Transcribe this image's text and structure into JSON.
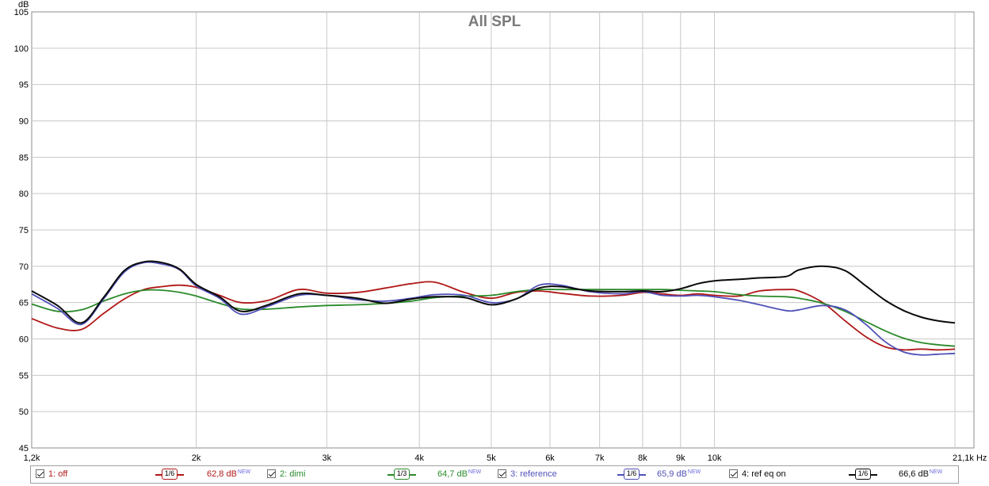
{
  "chart_data": {
    "type": "line",
    "title": "All SPL",
    "ylabel": "dB",
    "xlabel": "Hz",
    "x_scale": "log",
    "xlim": [
      1200,
      21100
    ],
    "ylim": [
      45,
      105
    ],
    "yticks": [
      45,
      50,
      55,
      60,
      65,
      70,
      75,
      80,
      85,
      90,
      95,
      100,
      105
    ],
    "xticks": [
      {
        "value": 1200,
        "label": "1,2k"
      },
      {
        "value": 2000,
        "label": "2k"
      },
      {
        "value": 3000,
        "label": "3k"
      },
      {
        "value": 4000,
        "label": "4k"
      },
      {
        "value": 5000,
        "label": "5k"
      },
      {
        "value": 6000,
        "label": "6k"
      },
      {
        "value": 7000,
        "label": "7k"
      },
      {
        "value": 8000,
        "label": "8k"
      },
      {
        "value": 9000,
        "label": "9k"
      },
      {
        "value": 10000,
        "label": "10k"
      },
      {
        "value": 21100,
        "label": "21,1k Hz"
      }
    ],
    "grid": true,
    "series": [
      {
        "name": "1: off",
        "color": "#b01818",
        "x": [
          1200,
          1300,
          1400,
          1500,
          1600,
          1700,
          1800,
          1900,
          2000,
          2150,
          2300,
          2500,
          2750,
          3000,
          3300,
          3600,
          3900,
          4200,
          4600,
          5000,
          5400,
          5800,
          6200,
          6800,
          7500,
          8000,
          8500,
          9000,
          9500,
          10000,
          10800,
          11500,
          12500,
          13000,
          14000,
          15000,
          16000,
          17000,
          18000,
          19000,
          20000,
          21100
        ],
        "y": [
          62.8,
          61.5,
          61.3,
          63.5,
          65.5,
          66.8,
          67.2,
          67.4,
          67.1,
          66.0,
          65.0,
          65.3,
          66.8,
          66.3,
          66.4,
          67.0,
          67.6,
          67.8,
          66.4,
          65.6,
          66.4,
          66.6,
          66.3,
          65.9,
          66.0,
          66.4,
          66.2,
          66.0,
          66.2,
          66.0,
          65.9,
          66.6,
          66.8,
          66.6,
          65.0,
          62.5,
          60.3,
          58.9,
          58.5,
          58.6,
          58.5,
          58.6
        ]
      },
      {
        "name": "2: dimi",
        "color": "#2a8a2a",
        "x": [
          1200,
          1300,
          1400,
          1500,
          1600,
          1700,
          1800,
          1900,
          2000,
          2150,
          2300,
          2500,
          2750,
          3000,
          3300,
          3600,
          3900,
          4200,
          4600,
          5000,
          5400,
          5800,
          6200,
          6800,
          7500,
          8000,
          8500,
          9000,
          9500,
          10000,
          10800,
          11500,
          12500,
          13000,
          14000,
          15000,
          16000,
          17000,
          18000,
          19000,
          20000,
          21100
        ],
        "y": [
          64.8,
          63.8,
          64.0,
          65.2,
          66.2,
          66.7,
          66.7,
          66.4,
          65.9,
          64.9,
          64.1,
          64.1,
          64.4,
          64.6,
          64.7,
          64.9,
          65.2,
          65.7,
          65.9,
          66.0,
          66.5,
          66.8,
          66.8,
          66.8,
          66.8,
          66.8,
          66.8,
          66.7,
          66.6,
          66.5,
          66.1,
          65.9,
          65.8,
          65.6,
          64.9,
          63.8,
          62.4,
          61.1,
          60.1,
          59.5,
          59.2,
          59.0
        ]
      },
      {
        "name": "3: reference",
        "color": "#5050b8",
        "x": [
          1200,
          1300,
          1400,
          1500,
          1600,
          1700,
          1800,
          1900,
          2000,
          2150,
          2300,
          2500,
          2750,
          3000,
          3300,
          3600,
          3900,
          4200,
          4600,
          5000,
          5400,
          5800,
          6200,
          6800,
          7500,
          8000,
          8500,
          9000,
          9500,
          10000,
          10800,
          11500,
          12500,
          13000,
          14000,
          15000,
          16000,
          17000,
          18000,
          19000,
          20000,
          21100
        ],
        "y": [
          66.2,
          64.2,
          62.0,
          65.5,
          69.2,
          70.5,
          70.3,
          69.5,
          67.3,
          65.6,
          63.4,
          64.5,
          66.0,
          66.0,
          65.4,
          65.2,
          65.6,
          66.1,
          66.0,
          65.0,
          65.5,
          67.4,
          67.4,
          66.5,
          66.2,
          66.5,
          66.0,
          65.9,
          66.0,
          65.8,
          65.3,
          64.7,
          63.9,
          64.0,
          64.6,
          64.0,
          62.0,
          59.6,
          58.2,
          57.8,
          57.9,
          58.0
        ]
      },
      {
        "name": "4: ref eq on",
        "color": "#0a0a0a",
        "x": [
          1200,
          1300,
          1400,
          1500,
          1600,
          1700,
          1800,
          1900,
          2000,
          2150,
          2300,
          2500,
          2750,
          3000,
          3300,
          3600,
          3900,
          4200,
          4600,
          5000,
          5400,
          5800,
          6200,
          6800,
          7500,
          8000,
          8500,
          9000,
          9500,
          10000,
          10800,
          11500,
          12500,
          13000,
          14000,
          15000,
          16000,
          17000,
          18000,
          19000,
          20000,
          21100
        ],
        "y": [
          66.6,
          64.6,
          62.2,
          65.7,
          69.4,
          70.6,
          70.5,
          69.6,
          67.5,
          65.8,
          63.8,
          64.7,
          66.2,
          66.0,
          65.6,
          64.9,
          65.5,
          65.8,
          65.7,
          64.7,
          65.5,
          67.0,
          67.2,
          66.6,
          66.5,
          66.6,
          66.5,
          66.9,
          67.6,
          68.0,
          68.2,
          68.4,
          68.6,
          69.5,
          70.0,
          69.4,
          67.3,
          65.3,
          63.9,
          63.0,
          62.5,
          62.2
        ]
      }
    ]
  },
  "legend": [
    {
      "label": "1: off",
      "smoothing": "1/6",
      "level": "62,8 dB",
      "badge": "NEW",
      "color": "#b01818"
    },
    {
      "label": "2: dimi",
      "smoothing": "1/3",
      "level": "64,7 dB",
      "badge": "NEW",
      "color": "#2a8a2a"
    },
    {
      "label": "3: reference",
      "smoothing": "1/6",
      "level": "65,9 dB",
      "badge": "NEW",
      "color": "#5050b8"
    },
    {
      "label": "4: ref eq on",
      "smoothing": "1/6",
      "level": "66,6 dB",
      "badge": "NEW",
      "color": "#0a0a0a"
    }
  ]
}
